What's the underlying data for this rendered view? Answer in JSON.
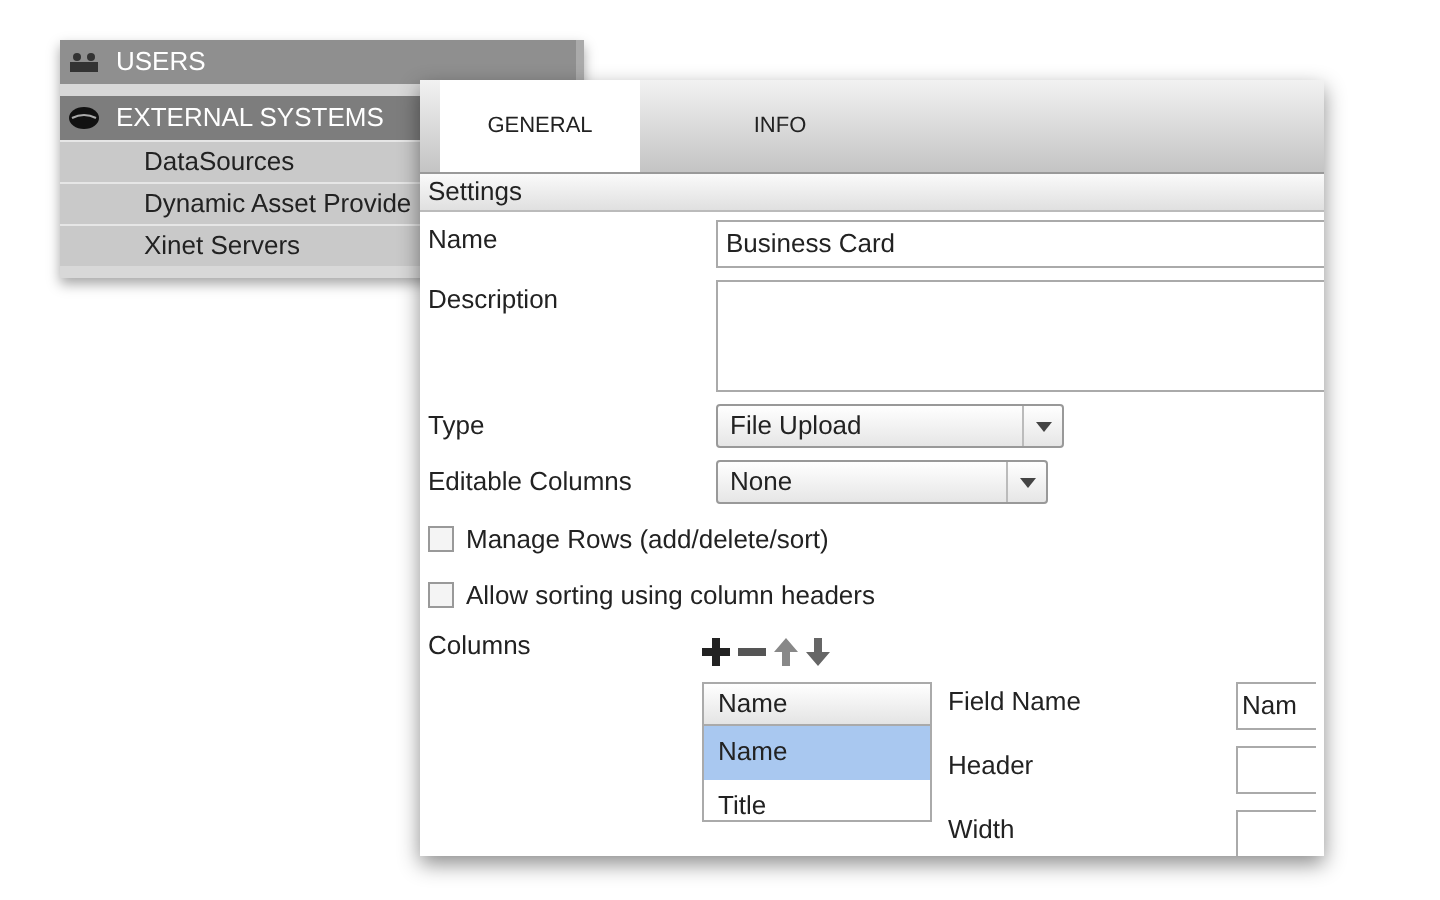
{
  "sidebar": {
    "sections": [
      {
        "label": "USERS",
        "kind": "users",
        "expanded": false
      },
      {
        "label": "EXTERNAL SYSTEMS",
        "kind": "systems",
        "expanded": true,
        "children": [
          {
            "label": "DataSources"
          },
          {
            "label": "Dynamic Asset Provide"
          },
          {
            "label": "Xinet Servers"
          }
        ]
      }
    ]
  },
  "dialog": {
    "tabs": [
      {
        "label": "GENERAL",
        "selected": true
      },
      {
        "label": "INFO",
        "selected": false
      }
    ],
    "section_title": "Settings",
    "name": {
      "label": "Name",
      "value": "Business Card"
    },
    "description": {
      "label": "Description"
    },
    "type": {
      "label": "Type",
      "value": "File Upload"
    },
    "editable_columns": {
      "label": "Editable Columns",
      "value": "None"
    },
    "checkboxes": [
      {
        "label": "Manage Rows (add/delete/sort)",
        "checked": false
      },
      {
        "label": "Allow sorting using column headers",
        "checked": false
      }
    ],
    "columns": {
      "label": "Columns",
      "list_header": "Name",
      "items": [
        {
          "label": "Name",
          "selected": true
        },
        {
          "label": "Title",
          "selected": false
        }
      ],
      "properties": [
        {
          "label": "Field Name",
          "value": "Nam"
        },
        {
          "label": "Header"
        },
        {
          "label": "Width"
        }
      ]
    }
  }
}
